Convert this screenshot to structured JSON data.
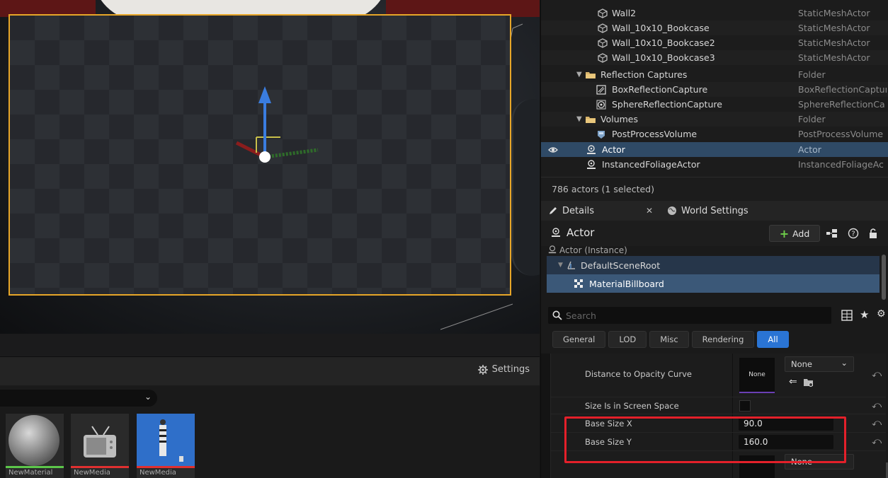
{
  "outliner": {
    "rows": [
      {
        "label": "Wall2",
        "type": "StaticMeshActor",
        "icon": "static-mesh-icon"
      },
      {
        "label": "Wall_10x10_Bookcase",
        "type": "StaticMeshActor",
        "icon": "static-mesh-icon"
      },
      {
        "label": "Wall_10x10_Bookcase2",
        "type": "StaticMeshActor",
        "icon": "static-mesh-icon"
      },
      {
        "label": "Wall_10x10_Bookcase3",
        "type": "StaticMeshActor",
        "icon": "static-mesh-icon"
      },
      {
        "label": "Reflection Captures",
        "type": "Folder",
        "icon": "folder-icon"
      },
      {
        "label": "BoxReflectionCapture",
        "type": "BoxReflectionCaptur",
        "icon": "box-reflection-icon"
      },
      {
        "label": "SphereReflectionCapture",
        "type": "SphereReflectionCa",
        "icon": "sphere-reflection-icon"
      },
      {
        "label": "Volumes",
        "type": "Folder",
        "icon": "folder-icon"
      },
      {
        "label": "PostProcessVolume",
        "type": "PostProcessVolume",
        "icon": "post-process-icon"
      },
      {
        "label": "Actor",
        "type": "Actor",
        "icon": "actor-icon",
        "selected": true
      },
      {
        "label": "InstancedFoliageActor",
        "type": "InstancedFoliageAc",
        "icon": "actor-icon"
      }
    ],
    "summary": "786 actors (1 selected)"
  },
  "details": {
    "tab_details": "Details",
    "tab_world": "World Settings",
    "actor_name": "Actor",
    "add_label": "Add",
    "components": {
      "instance": "Actor (Instance)",
      "root": "DefaultSceneRoot",
      "billboard": "MaterialBillboard"
    },
    "search_placeholder": "Search",
    "filter_tabs": [
      "General",
      "LOD",
      "Misc",
      "Rendering",
      "All"
    ],
    "active_filter": "All",
    "properties": {
      "opacity_curve_label": "Distance to Opacity Curve",
      "curve_thumb": "None",
      "curve_select": "None",
      "screen_space_label": "Size Is in Screen Space",
      "base_size_x_label": "Base Size X",
      "base_size_x": "90.0",
      "base_size_y_label": "Base Size Y",
      "base_size_y": "160.0",
      "last_select": "None"
    }
  },
  "content_browser": {
    "settings_label": "Settings",
    "assets": [
      {
        "name": "NewMaterial",
        "bar_color": "#5cc64a"
      },
      {
        "name": "NewMedia",
        "bar_color": "#e03030"
      },
      {
        "name": "NewMedia",
        "bar_color": "#e03030"
      }
    ]
  },
  "colors": {
    "selection": "#2f4a66",
    "billboard_outline": "#e7a628",
    "highlight": "#e4202a",
    "accent": "#2a74d4"
  }
}
